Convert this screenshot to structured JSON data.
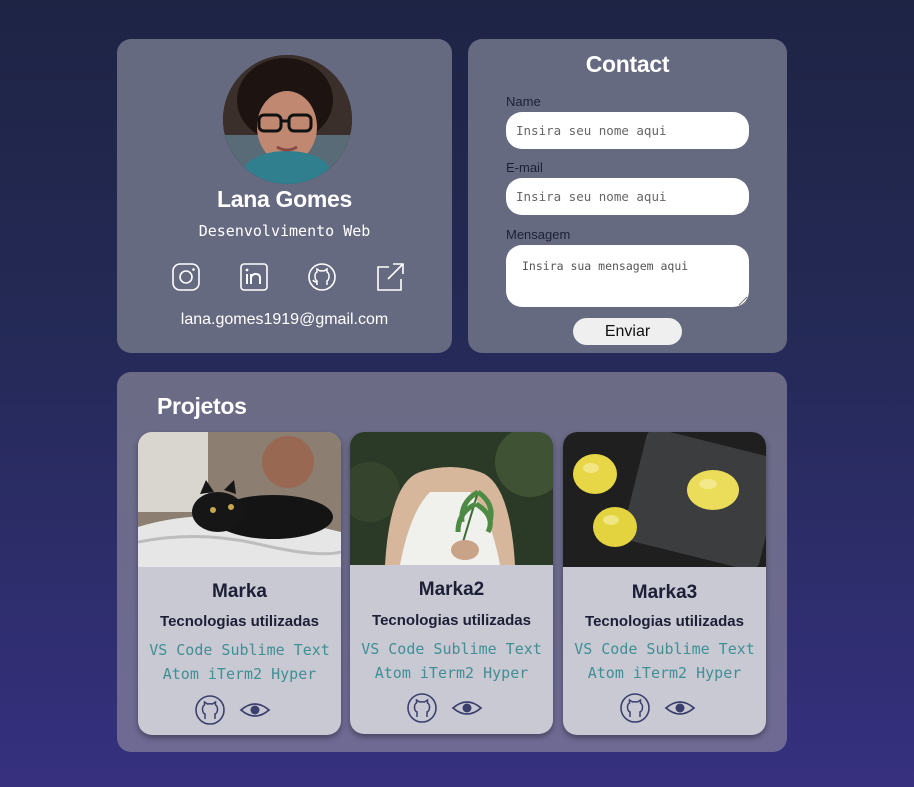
{
  "profile": {
    "name": "Lana Gomes",
    "role": "Desenvolvimento Web",
    "email": "lana.gomes1919@gmail.com",
    "social_icons": [
      "instagram-icon",
      "linkedin-icon",
      "github-icon",
      "external-link-icon"
    ]
  },
  "contact": {
    "title": "Contact",
    "name_label": "Name",
    "name_placeholder": "Insira seu nome aqui",
    "email_label": "E-mail",
    "email_placeholder": "Insira seu nome aqui",
    "message_label": "Mensagem",
    "message_placeholder": "Insira sua mensagem aqui",
    "send_label": "Enviar"
  },
  "projects": {
    "title": "Projetos",
    "cards": [
      {
        "name": "Marka",
        "tech_label": "Tecnologias utilizadas",
        "stack": "VS Code Sublime Text Atom iTerm2 Hyper",
        "image": "black-cat-photo"
      },
      {
        "name": "Marka2",
        "tech_label": "Tecnologias utilizadas",
        "stack": "VS Code Sublime Text Atom iTerm2 Hyper",
        "image": "woman-holding-leaf-photo"
      },
      {
        "name": "Marka3",
        "tech_label": "Tecnologias utilizadas",
        "stack": "VS Code Sublime Text Atom iTerm2 Hyper",
        "image": "lemons-on-slate-photo"
      }
    ]
  },
  "colors": {
    "panel": "#666a80",
    "card": "#c9c9d3",
    "dark_text": "#1c1f36",
    "stack_text": "#3f8f95",
    "icon_stroke": "#3b3f6e"
  }
}
